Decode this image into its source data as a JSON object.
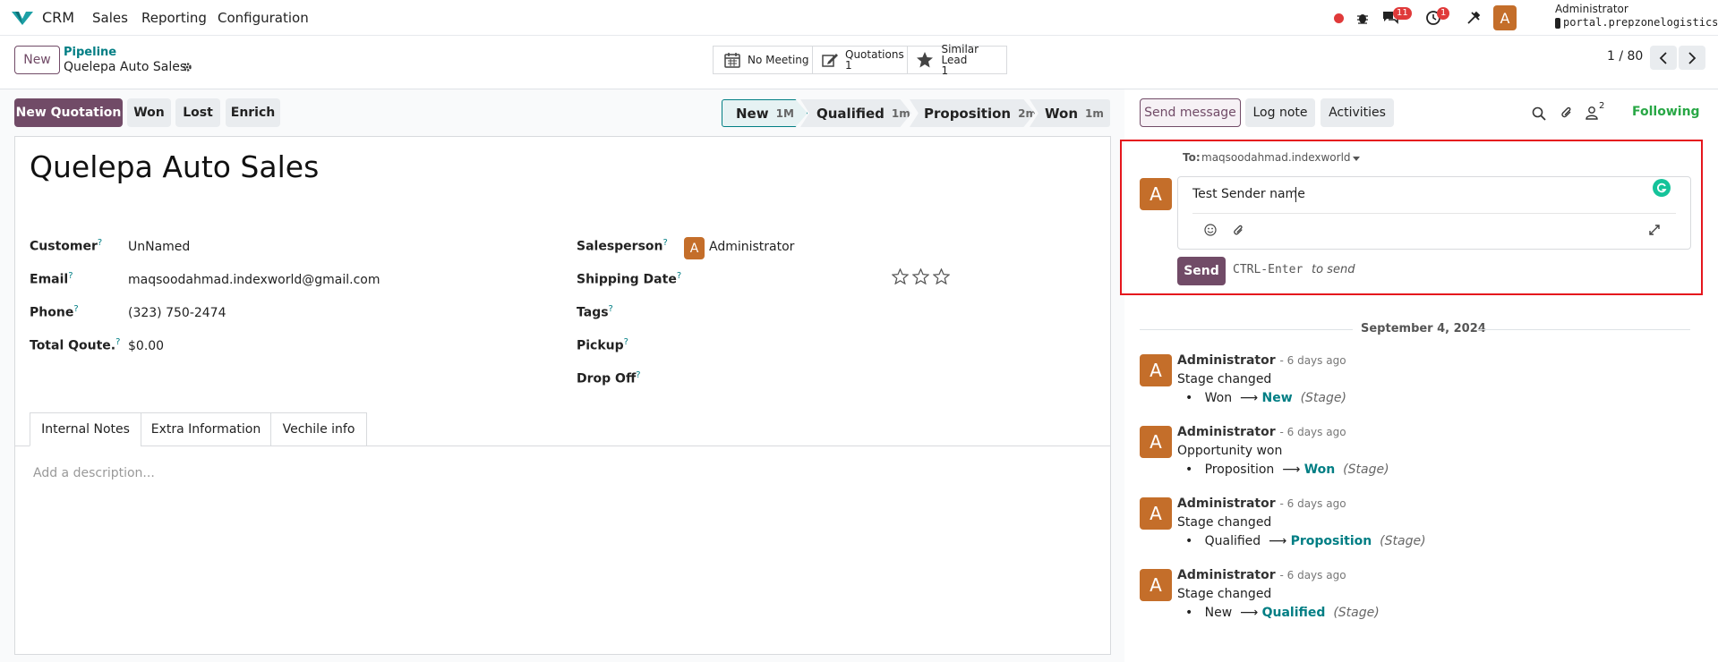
{
  "topnav": {
    "app_name": "CRM",
    "menus": [
      "Sales",
      "Reporting",
      "Configuration"
    ],
    "messages_count": "11",
    "activities_count": "1",
    "user_name": "Administrator",
    "user_db": "portal.prepzonelogistics...",
    "avatar_letter": "A"
  },
  "control": {
    "new_label": "New",
    "breadcrumb_parent": "Pipeline",
    "breadcrumb_current": "Quelepa Auto Sales",
    "pager": "1 / 80",
    "smart_buttons": {
      "meeting": "No Meeting",
      "quotations_label": "Quotations",
      "quotations_count": "1",
      "similar_label": "Similar Lead",
      "similar_count": "1"
    }
  },
  "actions": {
    "new_quotation": "New Quotation",
    "won": "Won",
    "lost": "Lost",
    "enrich": "Enrich"
  },
  "stages": [
    {
      "name": "New",
      "dur": "1M"
    },
    {
      "name": "Qualified",
      "dur": "1m"
    },
    {
      "name": "Proposition",
      "dur": "2m"
    },
    {
      "name": "Won",
      "dur": "1m"
    }
  ],
  "form": {
    "title": "Quelepa Auto Sales",
    "customer_label": "Customer",
    "customer_value": "UnNamed",
    "email_label": "Email",
    "email_value": "maqsoodahmad.indexworld@gmail.com",
    "phone_label": "Phone",
    "phone_value": "(323) 750-2474",
    "total_label": "Total Qoute.",
    "total_value": "$0.00",
    "salesperson_label": "Salesperson",
    "salesperson_value": "Administrator",
    "shipping_label": "Shipping Date",
    "tags_label": "Tags",
    "pickup_label": "Pickup",
    "dropoff_label": "Drop Off",
    "help_mark": "?",
    "priority_stars": 0,
    "tabs": [
      "Internal Notes",
      "Extra Information",
      "Vechile info"
    ],
    "description_placeholder": "Add a description..."
  },
  "chatter": {
    "send_message": "Send message",
    "log_note": "Log note",
    "activities": "Activities",
    "followers_count": "2",
    "following": "Following",
    "to_label": "To:",
    "to_value": "maqsoodahmad.indexworld",
    "composer_text": "Test Sender name",
    "send_label": "Send",
    "hint_keys": "CTRL-Enter",
    "hint_text": "to send",
    "date_separator": "September 4, 2024",
    "messages": [
      {
        "author": "Administrator",
        "date": "- 6 days ago",
        "body": "Stage changed",
        "from": "Won",
        "to": "New",
        "field": "(Stage)"
      },
      {
        "author": "Administrator",
        "date": "- 6 days ago",
        "body": "Opportunity won",
        "from": "Proposition",
        "to": "Won",
        "field": "(Stage)"
      },
      {
        "author": "Administrator",
        "date": "- 6 days ago",
        "body": "Stage changed",
        "from": "Qualified",
        "to": "Proposition",
        "field": "(Stage)"
      },
      {
        "author": "Administrator",
        "date": "- 6 days ago",
        "body": "Stage changed",
        "from": "New",
        "to": "Qualified",
        "field": "(Stage)"
      }
    ]
  },
  "colors": {
    "brand": "#714b67",
    "accent": "#017e84",
    "avatar": "#c46e2a",
    "highlight_box": "#e5161d",
    "badge": "#e03a3a"
  }
}
